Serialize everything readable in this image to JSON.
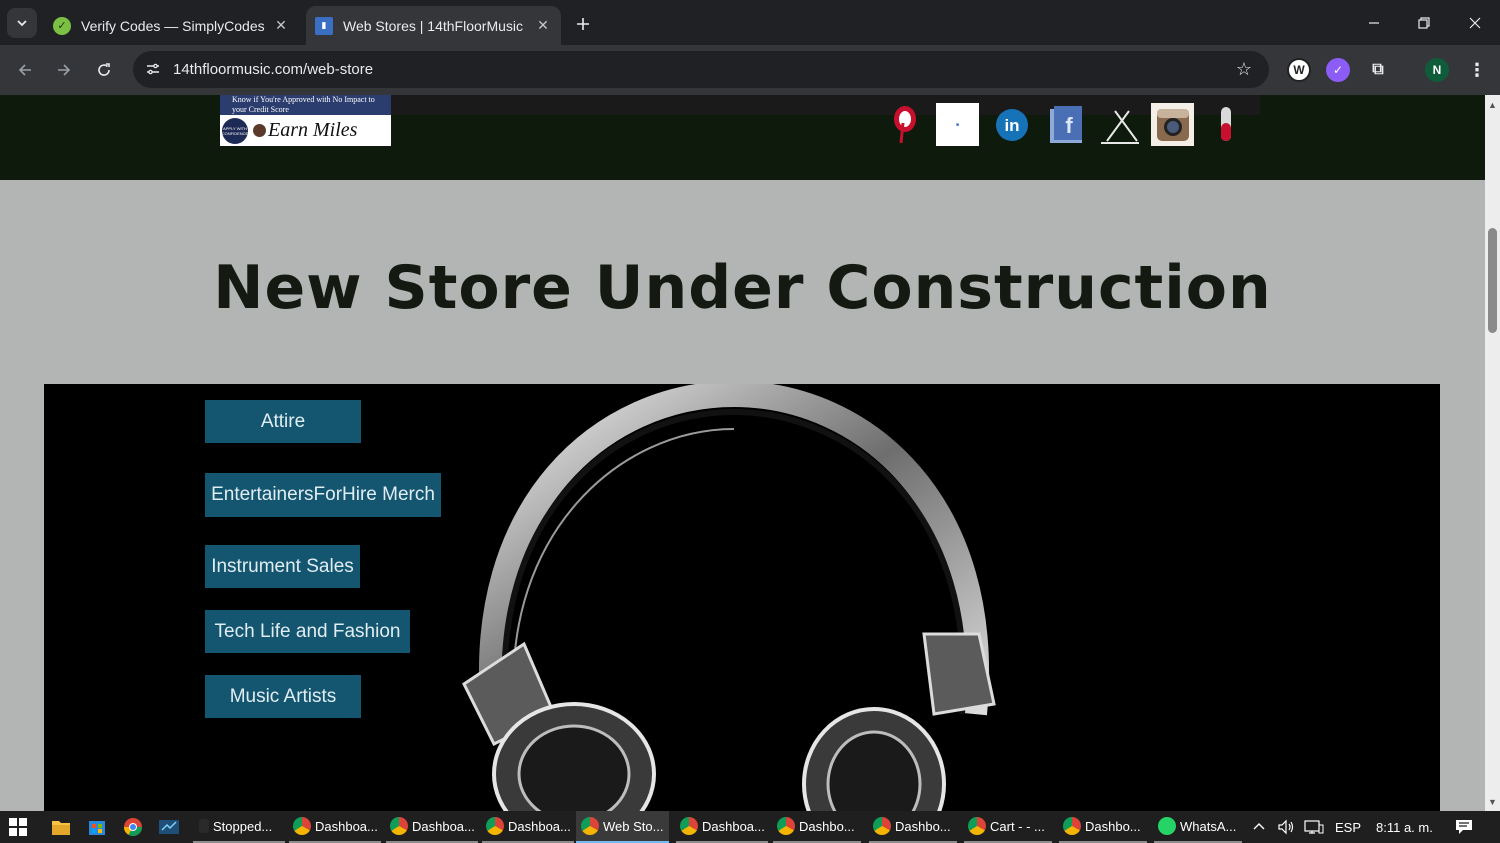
{
  "browser": {
    "tabs": [
      {
        "title": "Verify Codes — SimplyCodes",
        "active": false
      },
      {
        "title": "Web Stores | 14thFloorMusic",
        "active": true
      }
    ],
    "url": "14thfloormusic.com/web-store",
    "profile_initial": "N"
  },
  "site": {
    "ad": {
      "top_text": "Know if You're Approved with No Impact to your Credit Score",
      "seal_text": "APPLY WITH CONFIDENCE",
      "brand_text": "Earn Miles"
    },
    "social_icons": [
      "pinterest-icon",
      "blank-icon",
      "linkedin-icon",
      "facebook-icon",
      "x-icon",
      "instagram-icon",
      "red-pin-icon"
    ],
    "hero_title": "New Store Under Construction",
    "menu": [
      {
        "label": "Attire"
      },
      {
        "label": "EntertainersForHire Merch"
      },
      {
        "label": "Instrument Sales"
      },
      {
        "label": "Tech Life and Fashion"
      },
      {
        "label": "Music Artists"
      }
    ],
    "colors": {
      "header_bg": "#0e1a0b",
      "menu_bg": "#145570",
      "panel_bg": "#000000"
    }
  },
  "taskbar": {
    "items": [
      {
        "label": "Stopped...",
        "icon": "recorder-icon"
      },
      {
        "label": "Dashboa...",
        "icon": "chrome-icon"
      },
      {
        "label": "Dashboa...",
        "icon": "chrome-icon"
      },
      {
        "label": "Dashboa...",
        "icon": "chrome-icon"
      },
      {
        "label": "Web Sto...",
        "icon": "chrome-icon",
        "active": true
      },
      {
        "label": "Dashboa...",
        "icon": "chrome-icon"
      },
      {
        "label": "Dashbo...",
        "icon": "chrome-icon"
      },
      {
        "label": "Dashbo...",
        "icon": "chrome-icon"
      },
      {
        "label": "Cart - - ...",
        "icon": "chrome-icon"
      },
      {
        "label": "Dashbo...",
        "icon": "chrome-icon"
      },
      {
        "label": "WhatsA...",
        "icon": "whatsapp-icon"
      }
    ],
    "language": "ESP",
    "time": "8:11 a. m."
  }
}
